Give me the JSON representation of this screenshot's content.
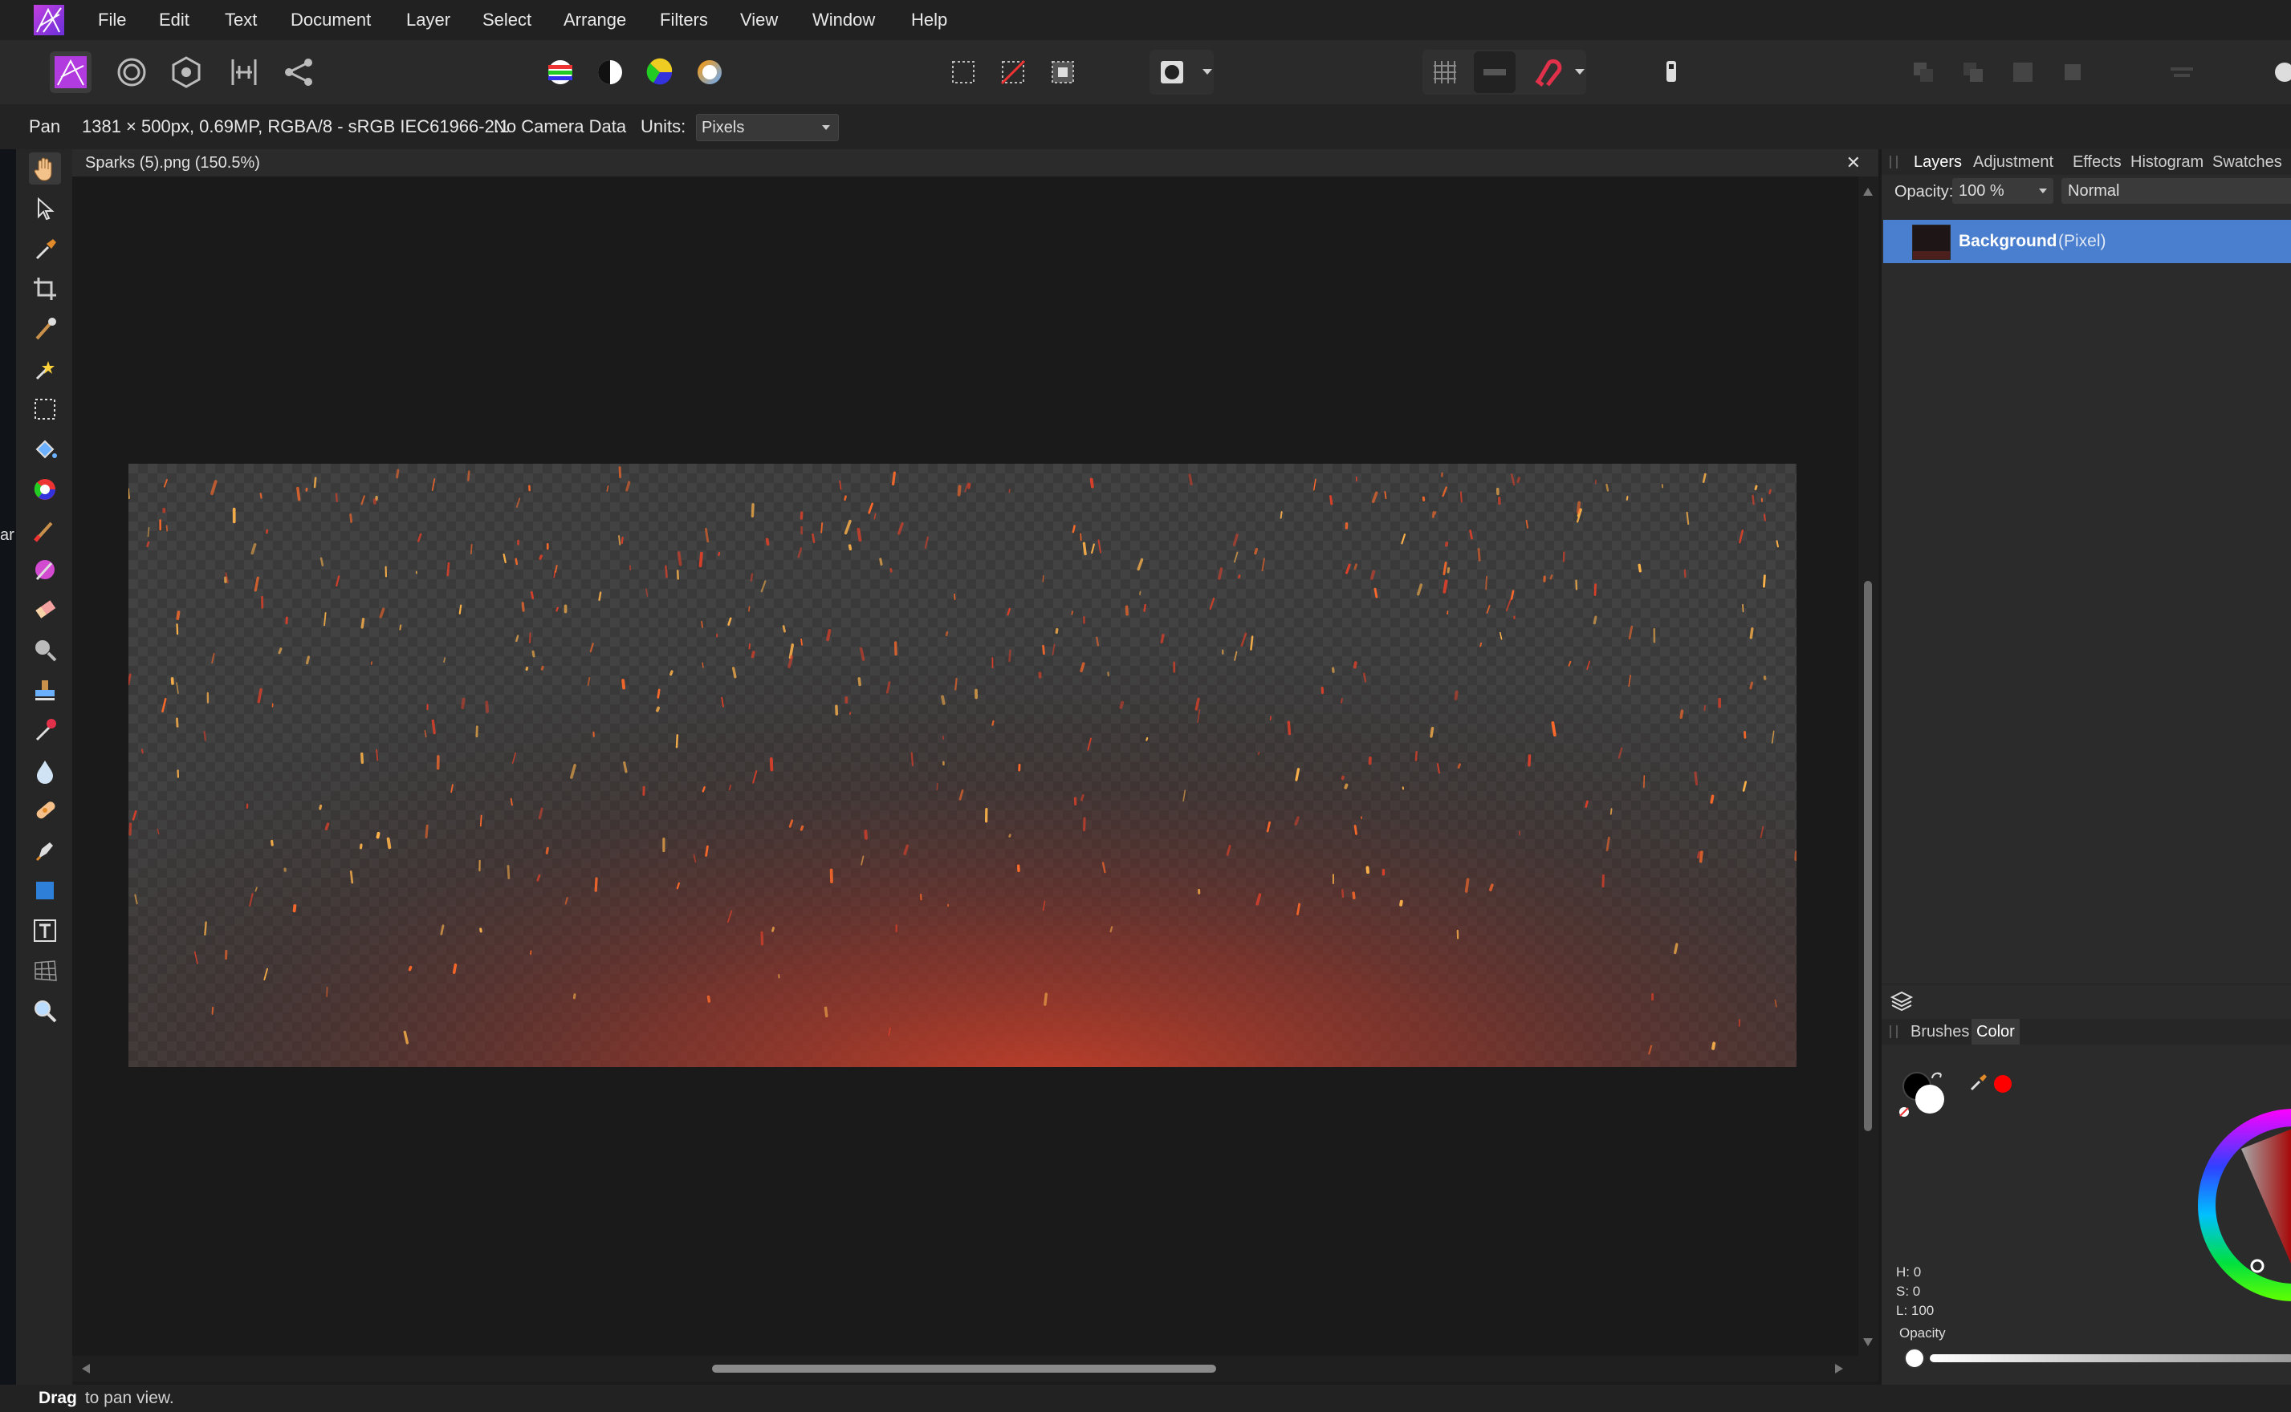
{
  "menu": [
    "File",
    "Edit",
    "Text",
    "Document",
    "Layer",
    "Select",
    "Arrange",
    "Filters",
    "View",
    "Window",
    "Help"
  ],
  "toolbar": {
    "personas": [
      "photo-persona-icon",
      "liquify-persona-icon",
      "develop-persona-icon",
      "tone-mapping-persona-icon",
      "export-persona-icon"
    ],
    "adjust": [
      "levels-icon",
      "contrast-icon",
      "color-wheel-icon",
      "white-balance-icon"
    ],
    "selection": [
      "marquee-icon",
      "deselect-icon",
      "invert-selection-icon"
    ],
    "mask": [
      "quick-mask-icon"
    ],
    "snapping": [
      "grid-icon",
      "align-icon",
      "snapping-magnet-icon"
    ],
    "misc": [
      "assistant-icon"
    ],
    "arrange": [
      "move-back-icon",
      "move-backward-icon",
      "move-forward-icon",
      "move-front-icon",
      "align-menu-icon",
      "more-icon"
    ]
  },
  "context": {
    "tool_name": "Pan",
    "image_info": "1381 × 500px, 0.69MP, RGBA/8 - sRGB IEC61966-2.1",
    "camera": "No Camera Data",
    "units_label": "Units:",
    "units_value": "Pixels"
  },
  "document": {
    "tab_title": "Sparks (5).png (150.5%)",
    "close_symbol": "✕"
  },
  "edge_fragment": "ar",
  "tools": [
    "hand-tool-icon",
    "move-tool-icon",
    "color-picker-tool-icon",
    "crop-tool-icon",
    "selection-brush-tool-icon",
    "flood-select-tool-icon",
    "rectangular-marquee-tool-icon",
    "flood-fill-tool-icon",
    "gradient-tool-icon",
    "paint-brush-tool-icon",
    "color-replacement-tool-icon",
    "erase-brush-tool-icon",
    "dodge-tool-icon",
    "clone-tool-icon",
    "smudge-tool-icon",
    "blur-tool-icon",
    "healing-tool-icon",
    "pen-tool-icon",
    "rectangle-tool-icon",
    "artistic-text-tool-icon",
    "mesh-warp-tool-icon",
    "zoom-tool-icon"
  ],
  "layers_panel": {
    "tabs": [
      "Layers",
      "Adjustment",
      "Effects",
      "Histogram",
      "Swatches"
    ],
    "opacity_label": "Opacity:",
    "opacity_value": "100 %",
    "blend_mode": "Normal",
    "layer": {
      "name": "Background",
      "type": "(Pixel)"
    }
  },
  "color_panel": {
    "tabs": [
      "Brushes",
      "Color"
    ],
    "h": "H: 0",
    "s": "S: 0",
    "l": "L: 100",
    "opacity_label": "Opacity",
    "accent": "#ff0000"
  },
  "status": {
    "bold": "Drag",
    "text": " to pan view."
  }
}
